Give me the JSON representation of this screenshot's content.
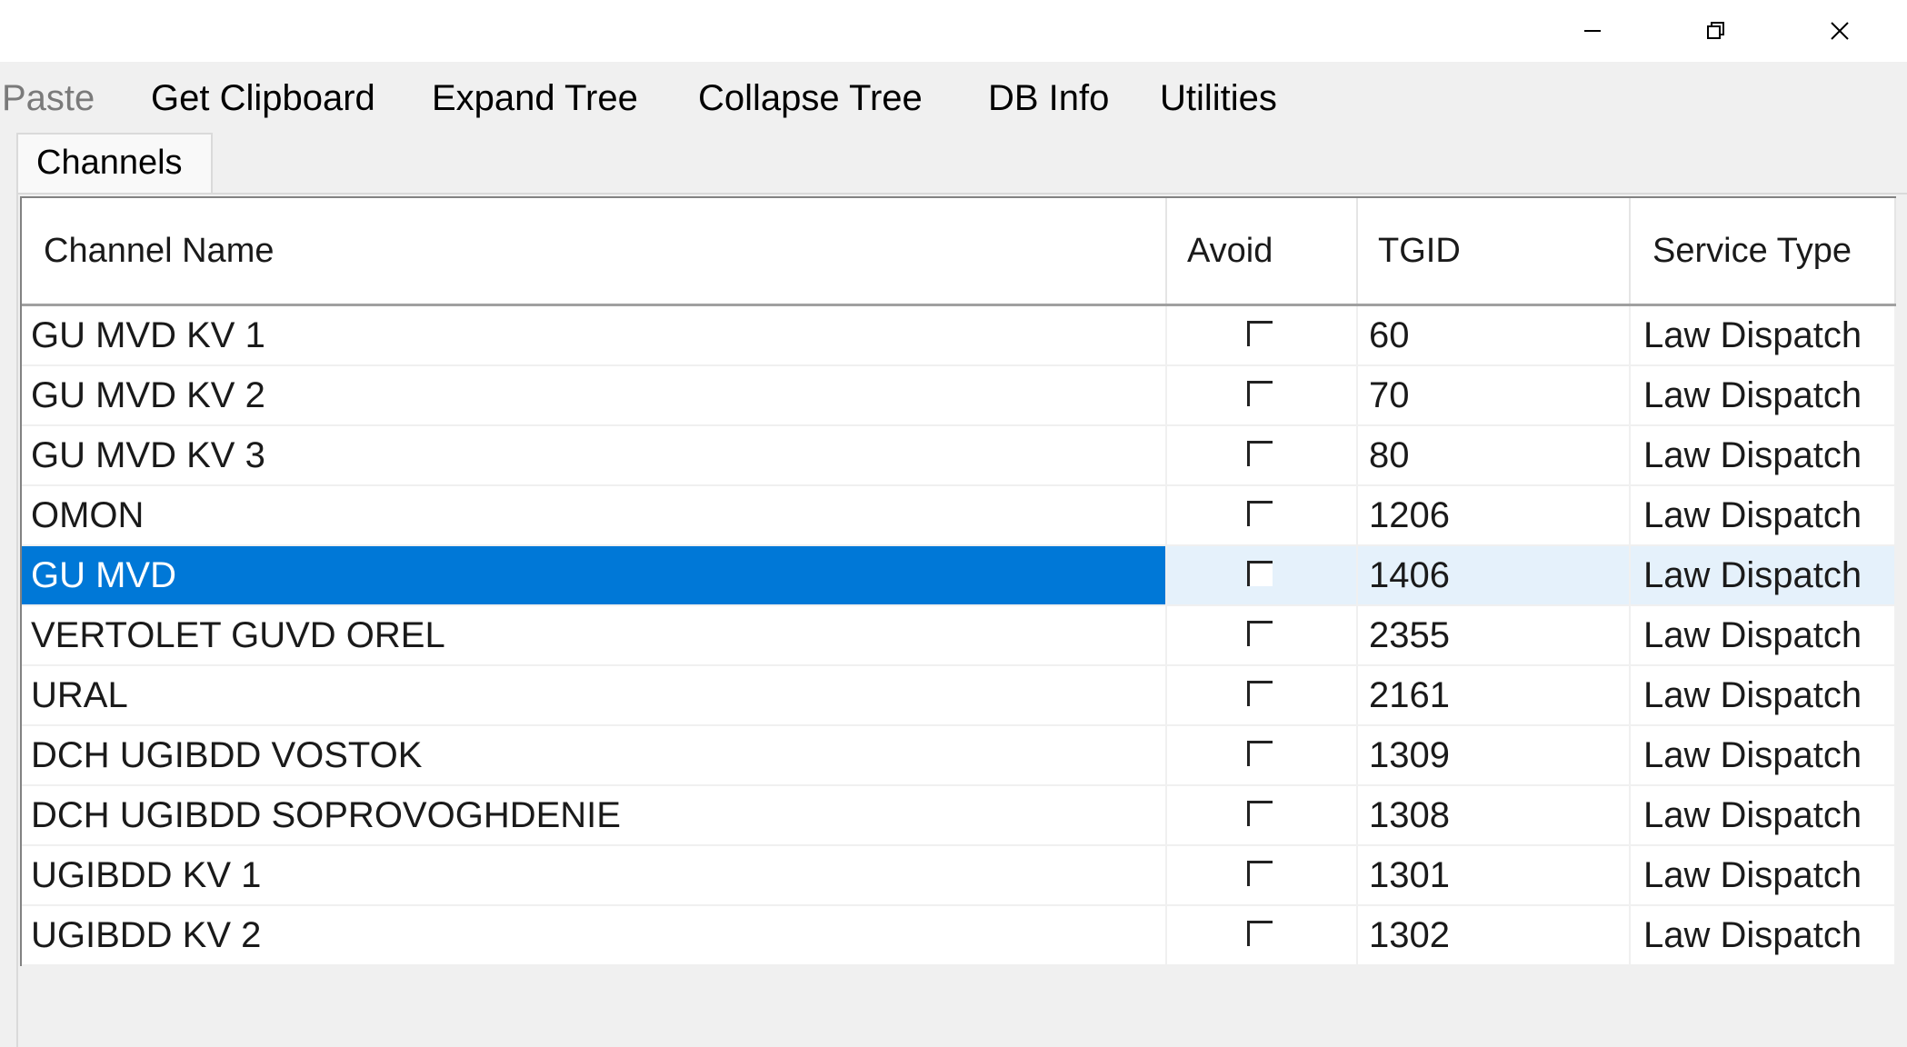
{
  "window": {
    "minimize_glyph": "minimize-icon",
    "restore_glyph": "restore-icon",
    "close_glyph": "close-icon"
  },
  "menu": {
    "items": [
      {
        "label": "Paste",
        "enabled": false
      },
      {
        "label": "Get Clipboard",
        "enabled": true
      },
      {
        "label": "Expand Tree",
        "enabled": true
      },
      {
        "label": "Collapse Tree",
        "enabled": true
      },
      {
        "label": "DB Info",
        "enabled": true
      },
      {
        "label": "Utilities",
        "enabled": true
      }
    ]
  },
  "tabs": [
    {
      "label": "Channels",
      "active": true
    }
  ],
  "table": {
    "columns": [
      "Channel Name",
      "Avoid",
      "TGID",
      "Service Type"
    ],
    "selected_row": 4,
    "selection_color": "#0078d7",
    "rows": [
      {
        "name": "GU MVD KV 1",
        "avoid": false,
        "tgid": "60",
        "type": "Law Dispatch"
      },
      {
        "name": "GU MVD KV 2",
        "avoid": false,
        "tgid": "70",
        "type": "Law Dispatch"
      },
      {
        "name": "GU MVD KV 3",
        "avoid": false,
        "tgid": "80",
        "type": "Law Dispatch"
      },
      {
        "name": "OMON",
        "avoid": false,
        "tgid": "1206",
        "type": "Law Dispatch"
      },
      {
        "name": "GU MVD",
        "avoid": false,
        "tgid": "1406",
        "type": "Law Dispatch"
      },
      {
        "name": "VERTOLET GUVD OREL",
        "avoid": false,
        "tgid": "2355",
        "type": "Law Dispatch"
      },
      {
        "name": "URAL",
        "avoid": false,
        "tgid": "2161",
        "type": "Law Dispatch"
      },
      {
        "name": "DCH UGIBDD VOSTOK",
        "avoid": false,
        "tgid": "1309",
        "type": "Law Dispatch"
      },
      {
        "name": "DCH UGIBDD SOPROVOGHDENIE",
        "avoid": false,
        "tgid": "1308",
        "type": "Law Dispatch"
      },
      {
        "name": "UGIBDD KV 1",
        "avoid": false,
        "tgid": "1301",
        "type": "Law Dispatch"
      },
      {
        "name": "UGIBDD KV 2",
        "avoid": false,
        "tgid": "1302",
        "type": "Law Dispatch"
      }
    ]
  }
}
